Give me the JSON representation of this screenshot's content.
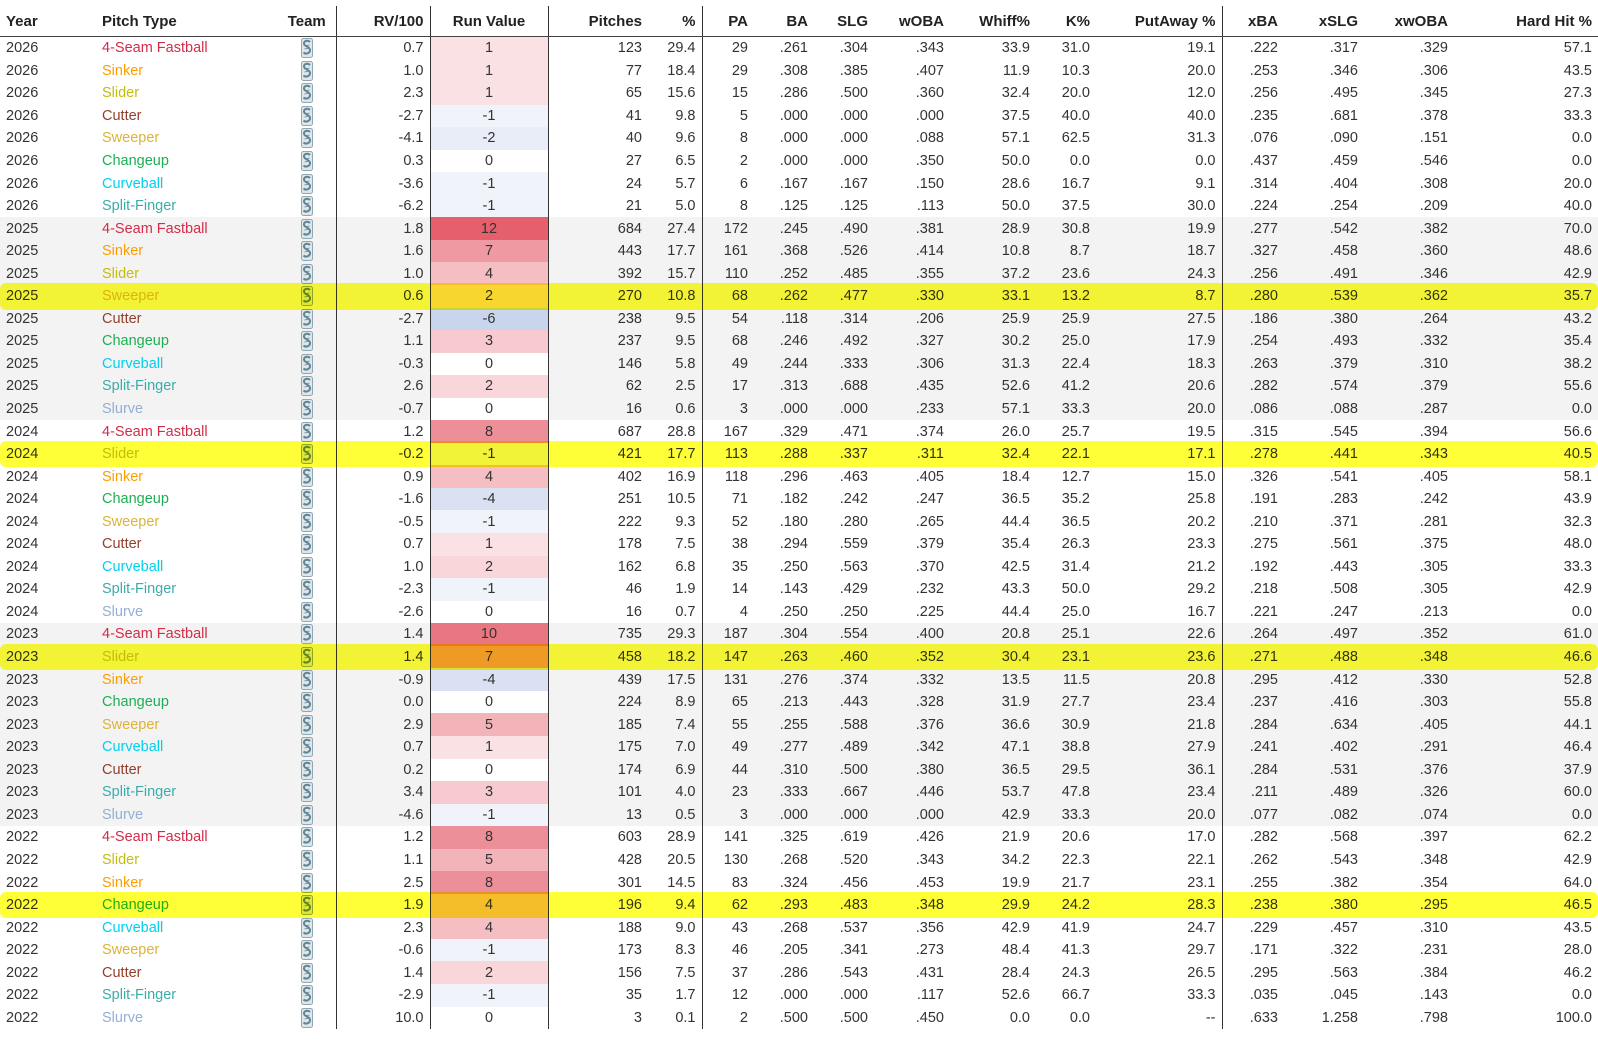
{
  "columns": [
    "Year",
    "Pitch Type",
    "Team",
    "RV/100",
    "Run Value",
    "Pitches",
    "%",
    "PA",
    "BA",
    "SLG",
    "wOBA",
    "Whiff%",
    "K%",
    "PutAway %",
    "xBA",
    "xSLG",
    "xwOBA",
    "Hard Hit %"
  ],
  "pitch_colors": {
    "4-Seam Fastball": "#d22d49",
    "Sinker": "#fe9d00",
    "Slider": "#c3bd0e",
    "Sweeper": "#ddb33a",
    "Cutter": "#933f2c",
    "Changeup": "#1db053",
    "Curveball": "#00d1ed",
    "Split-Finger": "#3bacac",
    "Slurve": "#93afd4"
  },
  "team_icon": "mariners-logo-icon",
  "highlight_color": "#ffff00",
  "chart_data": {
    "type": "table",
    "highlighted_rows": [
      11,
      18,
      27,
      38
    ],
    "rows": [
      {
        "year": "2026",
        "pitch": "4-Seam Fastball",
        "rv100": "0.7",
        "rv": "1",
        "pitches": "123",
        "pct": "29.4",
        "pa": "29",
        "ba": ".261",
        "slg": ".304",
        "woba": ".343",
        "whiff": "33.9",
        "k": "31.0",
        "putaway": "19.1",
        "xba": ".222",
        "xslg": ".317",
        "xwoba": ".329",
        "hardhit": "57.1"
      },
      {
        "year": "2026",
        "pitch": "Sinker",
        "rv100": "1.0",
        "rv": "1",
        "pitches": "77",
        "pct": "18.4",
        "pa": "29",
        "ba": ".308",
        "slg": ".385",
        "woba": ".407",
        "whiff": "11.9",
        "k": "10.3",
        "putaway": "20.0",
        "xba": ".253",
        "xslg": ".346",
        "xwoba": ".306",
        "hardhit": "43.5"
      },
      {
        "year": "2026",
        "pitch": "Slider",
        "rv100": "2.3",
        "rv": "1",
        "pitches": "65",
        "pct": "15.6",
        "pa": "15",
        "ba": ".286",
        "slg": ".500",
        "woba": ".360",
        "whiff": "32.4",
        "k": "20.0",
        "putaway": "12.0",
        "xba": ".256",
        "xslg": ".495",
        "xwoba": ".345",
        "hardhit": "27.3"
      },
      {
        "year": "2026",
        "pitch": "Cutter",
        "rv100": "-2.7",
        "rv": "-1",
        "pitches": "41",
        "pct": "9.8",
        "pa": "5",
        "ba": ".000",
        "slg": ".000",
        "woba": ".000",
        "whiff": "37.5",
        "k": "40.0",
        "putaway": "40.0",
        "xba": ".235",
        "xslg": ".681",
        "xwoba": ".378",
        "hardhit": "33.3"
      },
      {
        "year": "2026",
        "pitch": "Sweeper",
        "rv100": "-4.1",
        "rv": "-2",
        "pitches": "40",
        "pct": "9.6",
        "pa": "8",
        "ba": ".000",
        "slg": ".000",
        "woba": ".088",
        "whiff": "57.1",
        "k": "62.5",
        "putaway": "31.3",
        "xba": ".076",
        "xslg": ".090",
        "xwoba": ".151",
        "hardhit": "0.0"
      },
      {
        "year": "2026",
        "pitch": "Changeup",
        "rv100": "0.3",
        "rv": "0",
        "pitches": "27",
        "pct": "6.5",
        "pa": "2",
        "ba": ".000",
        "slg": ".000",
        "woba": ".350",
        "whiff": "50.0",
        "k": "0.0",
        "putaway": "0.0",
        "xba": ".437",
        "xslg": ".459",
        "xwoba": ".546",
        "hardhit": "0.0"
      },
      {
        "year": "2026",
        "pitch": "Curveball",
        "rv100": "-3.6",
        "rv": "-1",
        "pitches": "24",
        "pct": "5.7",
        "pa": "6",
        "ba": ".167",
        "slg": ".167",
        "woba": ".150",
        "whiff": "28.6",
        "k": "16.7",
        "putaway": "9.1",
        "xba": ".314",
        "xslg": ".404",
        "xwoba": ".308",
        "hardhit": "20.0"
      },
      {
        "year": "2026",
        "pitch": "Split-Finger",
        "rv100": "-6.2",
        "rv": "-1",
        "pitches": "21",
        "pct": "5.0",
        "pa": "8",
        "ba": ".125",
        "slg": ".125",
        "woba": ".113",
        "whiff": "50.0",
        "k": "37.5",
        "putaway": "30.0",
        "xba": ".224",
        "xslg": ".254",
        "xwoba": ".209",
        "hardhit": "40.0"
      },
      {
        "year": "2025",
        "pitch": "4-Seam Fastball",
        "rv100": "1.8",
        "rv": "12",
        "pitches": "684",
        "pct": "27.4",
        "pa": "172",
        "ba": ".245",
        "slg": ".490",
        "woba": ".381",
        "whiff": "28.9",
        "k": "30.8",
        "putaway": "19.9",
        "xba": ".277",
        "xslg": ".542",
        "xwoba": ".382",
        "hardhit": "70.0"
      },
      {
        "year": "2025",
        "pitch": "Sinker",
        "rv100": "1.6",
        "rv": "7",
        "pitches": "443",
        "pct": "17.7",
        "pa": "161",
        "ba": ".368",
        "slg": ".526",
        "woba": ".414",
        "whiff": "10.8",
        "k": "8.7",
        "putaway": "18.7",
        "xba": ".327",
        "xslg": ".458",
        "xwoba": ".360",
        "hardhit": "48.6"
      },
      {
        "year": "2025",
        "pitch": "Slider",
        "rv100": "1.0",
        "rv": "4",
        "pitches": "392",
        "pct": "15.7",
        "pa": "110",
        "ba": ".252",
        "slg": ".485",
        "woba": ".355",
        "whiff": "37.2",
        "k": "23.6",
        "putaway": "24.3",
        "xba": ".256",
        "xslg": ".491",
        "xwoba": ".346",
        "hardhit": "42.9"
      },
      {
        "year": "2025",
        "pitch": "Sweeper",
        "rv100": "0.6",
        "rv": "2",
        "pitches": "270",
        "pct": "10.8",
        "pa": "68",
        "ba": ".262",
        "slg": ".477",
        "woba": ".330",
        "whiff": "33.1",
        "k": "13.2",
        "putaway": "8.7",
        "xba": ".280",
        "xslg": ".539",
        "xwoba": ".362",
        "hardhit": "35.7"
      },
      {
        "year": "2025",
        "pitch": "Cutter",
        "rv100": "-2.7",
        "rv": "-6",
        "pitches": "238",
        "pct": "9.5",
        "pa": "54",
        "ba": ".118",
        "slg": ".314",
        "woba": ".206",
        "whiff": "25.9",
        "k": "25.9",
        "putaway": "27.5",
        "xba": ".186",
        "xslg": ".380",
        "xwoba": ".264",
        "hardhit": "43.2"
      },
      {
        "year": "2025",
        "pitch": "Changeup",
        "rv100": "1.1",
        "rv": "3",
        "pitches": "237",
        "pct": "9.5",
        "pa": "68",
        "ba": ".246",
        "slg": ".492",
        "woba": ".327",
        "whiff": "30.2",
        "k": "25.0",
        "putaway": "17.9",
        "xba": ".254",
        "xslg": ".493",
        "xwoba": ".332",
        "hardhit": "35.4"
      },
      {
        "year": "2025",
        "pitch": "Curveball",
        "rv100": "-0.3",
        "rv": "0",
        "pitches": "146",
        "pct": "5.8",
        "pa": "49",
        "ba": ".244",
        "slg": ".333",
        "woba": ".306",
        "whiff": "31.3",
        "k": "22.4",
        "putaway": "18.3",
        "xba": ".263",
        "xslg": ".379",
        "xwoba": ".310",
        "hardhit": "38.2"
      },
      {
        "year": "2025",
        "pitch": "Split-Finger",
        "rv100": "2.6",
        "rv": "2",
        "pitches": "62",
        "pct": "2.5",
        "pa": "17",
        "ba": ".313",
        "slg": ".688",
        "woba": ".435",
        "whiff": "52.6",
        "k": "41.2",
        "putaway": "20.6",
        "xba": ".282",
        "xslg": ".574",
        "xwoba": ".379",
        "hardhit": "55.6"
      },
      {
        "year": "2025",
        "pitch": "Slurve",
        "rv100": "-0.7",
        "rv": "0",
        "pitches": "16",
        "pct": "0.6",
        "pa": "3",
        "ba": ".000",
        "slg": ".000",
        "woba": ".233",
        "whiff": "57.1",
        "k": "33.3",
        "putaway": "20.0",
        "xba": ".086",
        "xslg": ".088",
        "xwoba": ".287",
        "hardhit": "0.0"
      },
      {
        "year": "2024",
        "pitch": "4-Seam Fastball",
        "rv100": "1.2",
        "rv": "8",
        "pitches": "687",
        "pct": "28.8",
        "pa": "167",
        "ba": ".329",
        "slg": ".471",
        "woba": ".374",
        "whiff": "26.0",
        "k": "25.7",
        "putaway": "19.5",
        "xba": ".315",
        "xslg": ".545",
        "xwoba": ".394",
        "hardhit": "56.6"
      },
      {
        "year": "2024",
        "pitch": "Slider",
        "rv100": "-0.2",
        "rv": "-1",
        "pitches": "421",
        "pct": "17.7",
        "pa": "113",
        "ba": ".288",
        "slg": ".337",
        "woba": ".311",
        "whiff": "32.4",
        "k": "22.1",
        "putaway": "17.1",
        "xba": ".278",
        "xslg": ".441",
        "xwoba": ".343",
        "hardhit": "40.5"
      },
      {
        "year": "2024",
        "pitch": "Sinker",
        "rv100": "0.9",
        "rv": "4",
        "pitches": "402",
        "pct": "16.9",
        "pa": "118",
        "ba": ".296",
        "slg": ".463",
        "woba": ".405",
        "whiff": "18.4",
        "k": "12.7",
        "putaway": "15.0",
        "xba": ".326",
        "xslg": ".541",
        "xwoba": ".405",
        "hardhit": "58.1"
      },
      {
        "year": "2024",
        "pitch": "Changeup",
        "rv100": "-1.6",
        "rv": "-4",
        "pitches": "251",
        "pct": "10.5",
        "pa": "71",
        "ba": ".182",
        "slg": ".242",
        "woba": ".247",
        "whiff": "36.5",
        "k": "35.2",
        "putaway": "25.8",
        "xba": ".191",
        "xslg": ".283",
        "xwoba": ".242",
        "hardhit": "43.9"
      },
      {
        "year": "2024",
        "pitch": "Sweeper",
        "rv100": "-0.5",
        "rv": "-1",
        "pitches": "222",
        "pct": "9.3",
        "pa": "52",
        "ba": ".180",
        "slg": ".280",
        "woba": ".265",
        "whiff": "44.4",
        "k": "36.5",
        "putaway": "20.2",
        "xba": ".210",
        "xslg": ".371",
        "xwoba": ".281",
        "hardhit": "32.3"
      },
      {
        "year": "2024",
        "pitch": "Cutter",
        "rv100": "0.7",
        "rv": "1",
        "pitches": "178",
        "pct": "7.5",
        "pa": "38",
        "ba": ".294",
        "slg": ".559",
        "woba": ".379",
        "whiff": "35.4",
        "k": "26.3",
        "putaway": "23.3",
        "xba": ".275",
        "xslg": ".561",
        "xwoba": ".375",
        "hardhit": "48.0"
      },
      {
        "year": "2024",
        "pitch": "Curveball",
        "rv100": "1.0",
        "rv": "2",
        "pitches": "162",
        "pct": "6.8",
        "pa": "35",
        "ba": ".250",
        "slg": ".563",
        "woba": ".370",
        "whiff": "42.5",
        "k": "31.4",
        "putaway": "21.2",
        "xba": ".192",
        "xslg": ".443",
        "xwoba": ".305",
        "hardhit": "33.3"
      },
      {
        "year": "2024",
        "pitch": "Split-Finger",
        "rv100": "-2.3",
        "rv": "-1",
        "pitches": "46",
        "pct": "1.9",
        "pa": "14",
        "ba": ".143",
        "slg": ".429",
        "woba": ".232",
        "whiff": "43.3",
        "k": "50.0",
        "putaway": "29.2",
        "xba": ".218",
        "xslg": ".508",
        "xwoba": ".305",
        "hardhit": "42.9"
      },
      {
        "year": "2024",
        "pitch": "Slurve",
        "rv100": "-2.6",
        "rv": "0",
        "pitches": "16",
        "pct": "0.7",
        "pa": "4",
        "ba": ".250",
        "slg": ".250",
        "woba": ".225",
        "whiff": "44.4",
        "k": "25.0",
        "putaway": "16.7",
        "xba": ".221",
        "xslg": ".247",
        "xwoba": ".213",
        "hardhit": "0.0"
      },
      {
        "year": "2023",
        "pitch": "4-Seam Fastball",
        "rv100": "1.4",
        "rv": "10",
        "pitches": "735",
        "pct": "29.3",
        "pa": "187",
        "ba": ".304",
        "slg": ".554",
        "woba": ".400",
        "whiff": "20.8",
        "k": "25.1",
        "putaway": "22.6",
        "xba": ".264",
        "xslg": ".497",
        "xwoba": ".352",
        "hardhit": "61.0"
      },
      {
        "year": "2023",
        "pitch": "Slider",
        "rv100": "1.4",
        "rv": "7",
        "pitches": "458",
        "pct": "18.2",
        "pa": "147",
        "ba": ".263",
        "slg": ".460",
        "woba": ".352",
        "whiff": "30.4",
        "k": "23.1",
        "putaway": "23.6",
        "xba": ".271",
        "xslg": ".488",
        "xwoba": ".348",
        "hardhit": "46.6"
      },
      {
        "year": "2023",
        "pitch": "Sinker",
        "rv100": "-0.9",
        "rv": "-4",
        "pitches": "439",
        "pct": "17.5",
        "pa": "131",
        "ba": ".276",
        "slg": ".374",
        "woba": ".332",
        "whiff": "13.5",
        "k": "11.5",
        "putaway": "20.8",
        "xba": ".295",
        "xslg": ".412",
        "xwoba": ".330",
        "hardhit": "52.8"
      },
      {
        "year": "2023",
        "pitch": "Changeup",
        "rv100": "0.0",
        "rv": "0",
        "pitches": "224",
        "pct": "8.9",
        "pa": "65",
        "ba": ".213",
        "slg": ".443",
        "woba": ".328",
        "whiff": "31.9",
        "k": "27.7",
        "putaway": "23.4",
        "xba": ".237",
        "xslg": ".416",
        "xwoba": ".303",
        "hardhit": "55.8"
      },
      {
        "year": "2023",
        "pitch": "Sweeper",
        "rv100": "2.9",
        "rv": "5",
        "pitches": "185",
        "pct": "7.4",
        "pa": "55",
        "ba": ".255",
        "slg": ".588",
        "woba": ".376",
        "whiff": "36.6",
        "k": "30.9",
        "putaway": "21.8",
        "xba": ".284",
        "xslg": ".634",
        "xwoba": ".405",
        "hardhit": "44.1"
      },
      {
        "year": "2023",
        "pitch": "Curveball",
        "rv100": "0.7",
        "rv": "1",
        "pitches": "175",
        "pct": "7.0",
        "pa": "49",
        "ba": ".277",
        "slg": ".489",
        "woba": ".342",
        "whiff": "47.1",
        "k": "38.8",
        "putaway": "27.9",
        "xba": ".241",
        "xslg": ".402",
        "xwoba": ".291",
        "hardhit": "46.4"
      },
      {
        "year": "2023",
        "pitch": "Cutter",
        "rv100": "0.2",
        "rv": "0",
        "pitches": "174",
        "pct": "6.9",
        "pa": "44",
        "ba": ".310",
        "slg": ".500",
        "woba": ".380",
        "whiff": "36.5",
        "k": "29.5",
        "putaway": "36.1",
        "xba": ".284",
        "xslg": ".531",
        "xwoba": ".376",
        "hardhit": "37.9"
      },
      {
        "year": "2023",
        "pitch": "Split-Finger",
        "rv100": "3.4",
        "rv": "3",
        "pitches": "101",
        "pct": "4.0",
        "pa": "23",
        "ba": ".333",
        "slg": ".667",
        "woba": ".446",
        "whiff": "53.7",
        "k": "47.8",
        "putaway": "23.4",
        "xba": ".211",
        "xslg": ".489",
        "xwoba": ".326",
        "hardhit": "60.0"
      },
      {
        "year": "2023",
        "pitch": "Slurve",
        "rv100": "-4.6",
        "rv": "-1",
        "pitches": "13",
        "pct": "0.5",
        "pa": "3",
        "ba": ".000",
        "slg": ".000",
        "woba": ".000",
        "whiff": "42.9",
        "k": "33.3",
        "putaway": "20.0",
        "xba": ".077",
        "xslg": ".082",
        "xwoba": ".074",
        "hardhit": "0.0"
      },
      {
        "year": "2022",
        "pitch": "4-Seam Fastball",
        "rv100": "1.2",
        "rv": "8",
        "pitches": "603",
        "pct": "28.9",
        "pa": "141",
        "ba": ".325",
        "slg": ".619",
        "woba": ".426",
        "whiff": "21.9",
        "k": "20.6",
        "putaway": "17.0",
        "xba": ".282",
        "xslg": ".568",
        "xwoba": ".397",
        "hardhit": "62.2"
      },
      {
        "year": "2022",
        "pitch": "Slider",
        "rv100": "1.1",
        "rv": "5",
        "pitches": "428",
        "pct": "20.5",
        "pa": "130",
        "ba": ".268",
        "slg": ".520",
        "woba": ".343",
        "whiff": "34.2",
        "k": "22.3",
        "putaway": "22.1",
        "xba": ".262",
        "xslg": ".543",
        "xwoba": ".348",
        "hardhit": "42.9"
      },
      {
        "year": "2022",
        "pitch": "Sinker",
        "rv100": "2.5",
        "rv": "8",
        "pitches": "301",
        "pct": "14.5",
        "pa": "83",
        "ba": ".324",
        "slg": ".456",
        "woba": ".453",
        "whiff": "19.9",
        "k": "21.7",
        "putaway": "23.1",
        "xba": ".255",
        "xslg": ".382",
        "xwoba": ".354",
        "hardhit": "64.0"
      },
      {
        "year": "2022",
        "pitch": "Changeup",
        "rv100": "1.9",
        "rv": "4",
        "pitches": "196",
        "pct": "9.4",
        "pa": "62",
        "ba": ".293",
        "slg": ".483",
        "woba": ".348",
        "whiff": "29.9",
        "k": "24.2",
        "putaway": "28.3",
        "xba": ".238",
        "xslg": ".380",
        "xwoba": ".295",
        "hardhit": "46.5"
      },
      {
        "year": "2022",
        "pitch": "Curveball",
        "rv100": "2.3",
        "rv": "4",
        "pitches": "188",
        "pct": "9.0",
        "pa": "43",
        "ba": ".268",
        "slg": ".537",
        "woba": ".356",
        "whiff": "42.9",
        "k": "41.9",
        "putaway": "24.7",
        "xba": ".229",
        "xslg": ".457",
        "xwoba": ".310",
        "hardhit": "43.5"
      },
      {
        "year": "2022",
        "pitch": "Sweeper",
        "rv100": "-0.6",
        "rv": "-1",
        "pitches": "173",
        "pct": "8.3",
        "pa": "46",
        "ba": ".205",
        "slg": ".341",
        "woba": ".273",
        "whiff": "48.4",
        "k": "41.3",
        "putaway": "29.7",
        "xba": ".171",
        "xslg": ".322",
        "xwoba": ".231",
        "hardhit": "28.0"
      },
      {
        "year": "2022",
        "pitch": "Cutter",
        "rv100": "1.4",
        "rv": "2",
        "pitches": "156",
        "pct": "7.5",
        "pa": "37",
        "ba": ".286",
        "slg": ".543",
        "woba": ".431",
        "whiff": "28.4",
        "k": "24.3",
        "putaway": "26.5",
        "xba": ".295",
        "xslg": ".563",
        "xwoba": ".384",
        "hardhit": "46.2"
      },
      {
        "year": "2022",
        "pitch": "Split-Finger",
        "rv100": "-2.9",
        "rv": "-1",
        "pitches": "35",
        "pct": "1.7",
        "pa": "12",
        "ba": ".000",
        "slg": ".000",
        "woba": ".117",
        "whiff": "52.6",
        "k": "66.7",
        "putaway": "33.3",
        "xba": ".035",
        "xslg": ".045",
        "xwoba": ".143",
        "hardhit": "0.0"
      },
      {
        "year": "2022",
        "pitch": "Slurve",
        "rv100": "10.0",
        "rv": "0",
        "pitches": "3",
        "pct": "0.1",
        "pa": "2",
        "ba": ".500",
        "slg": ".500",
        "woba": ".450",
        "whiff": "0.0",
        "k": "0.0",
        "putaway": "--",
        "xba": ".633",
        "xslg": "1.258",
        "xwoba": ".798",
        "hardhit": "100.0"
      }
    ]
  }
}
